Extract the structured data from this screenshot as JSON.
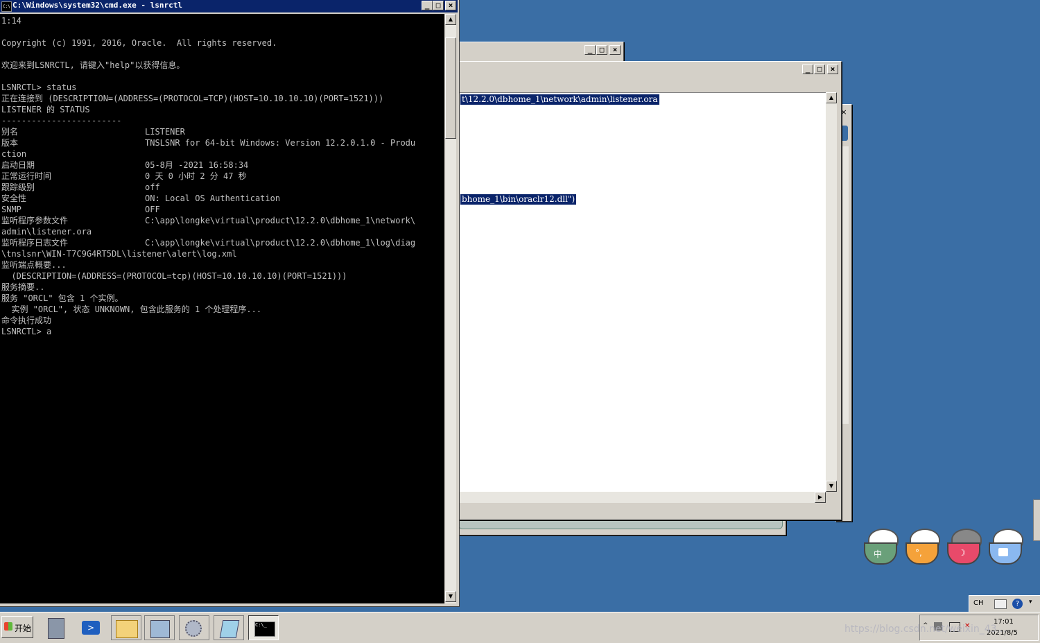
{
  "cmd_window": {
    "title": "C:\\Windows\\system32\\cmd.exe - lsnrctl",
    "icon": "cmd-icon",
    "icon_text": "C:\\",
    "buttons": {
      "minimize": "_",
      "maximize": "□",
      "close": "×"
    },
    "lines": [
      "1:14",
      "",
      "Copyright (c) 1991, 2016, Oracle.  All rights reserved.",
      "",
      "欢迎来到LSNRCTL, 请键入\"help\"以获得信息。",
      "",
      "LSNRCTL> status",
      "正在连接到 (DESCRIPTION=(ADDRESS=(PROTOCOL=TCP)(HOST=10.10.10.10)(PORT=1521)))",
      "LISTENER 的 STATUS",
      "------------------------"
    ],
    "status_rows": [
      {
        "label": "别名",
        "value": "LISTENER"
      },
      {
        "label": "版本",
        "value": "TNSLSNR for 64-bit Windows: Version 12.2.0.1.0 - Produ"
      },
      {
        "label": "ction",
        "value": ""
      },
      {
        "label": "启动日期",
        "value": "05-8月 -2021 16:58:34"
      },
      {
        "label": "正常运行时间",
        "value": "0 天 0 小时 2 分 47 秒"
      },
      {
        "label": "跟踪级别",
        "value": "off"
      },
      {
        "label": "安全性",
        "value": "ON: Local OS Authentication"
      },
      {
        "label": "SNMP",
        "value": "OFF"
      },
      {
        "label": "监听程序参数文件",
        "value": "C:\\app\\longke\\virtual\\product\\12.2.0\\dbhome_1\\network\\"
      },
      {
        "label": "admin\\listener.ora",
        "value": ""
      },
      {
        "label": "监听程序日志文件",
        "value": "C:\\app\\longke\\virtual\\product\\12.2.0\\dbhome_1\\log\\diag"
      },
      {
        "label": "\\tnslsnr\\WIN-T7C9G4RT5DL\\listener\\alert\\log.xml",
        "value": ""
      }
    ],
    "tail_lines": [
      "监听端点概要...",
      "  (DESCRIPTION=(ADDRESS=(PROTOCOL=tcp)(HOST=10.10.10.10)(PORT=1521)))",
      "服务摘要..",
      "服务 \"ORCL\" 包含 1 个实例。",
      "  实例 \"ORCL\", 状态 UNKNOWN, 包含此服务的 1 个处理程序...",
      "命令执行成功",
      "LSNRCTL> a"
    ]
  },
  "editor_window": {
    "selected_line_1": "t\\12.2.0\\dbhome_1\\network\\admin\\listener.ora",
    "selected_line_2": "bhome_1\\bin\\oraclr12.dll\")"
  },
  "taskbar": {
    "start_label": "开始",
    "items": [
      {
        "icon": "server-manager-icon"
      },
      {
        "icon": "powershell-icon"
      },
      {
        "icon": "explorer-icon"
      },
      {
        "icon": "network-icon"
      },
      {
        "icon": "settings-icon"
      },
      {
        "icon": "notepad-icon"
      },
      {
        "icon": "cmd-icon"
      }
    ],
    "clock_time": "17:01",
    "clock_date": "2021/8/5",
    "lang": "CH",
    "watermark": "https://blog.csdn.net/weixin_43..."
  },
  "desktop": {
    "cups": [
      {
        "name": "zhong",
        "glyph": "中",
        "color": "#6aa07a"
      },
      {
        "name": "punctuation",
        "glyph": "°,",
        "color": "#f5a23a"
      },
      {
        "name": "moon",
        "glyph": "☽",
        "color": "#e84a6a"
      },
      {
        "name": "shirt",
        "glyph": "👕",
        "color": "#8ab8f0"
      }
    ]
  }
}
